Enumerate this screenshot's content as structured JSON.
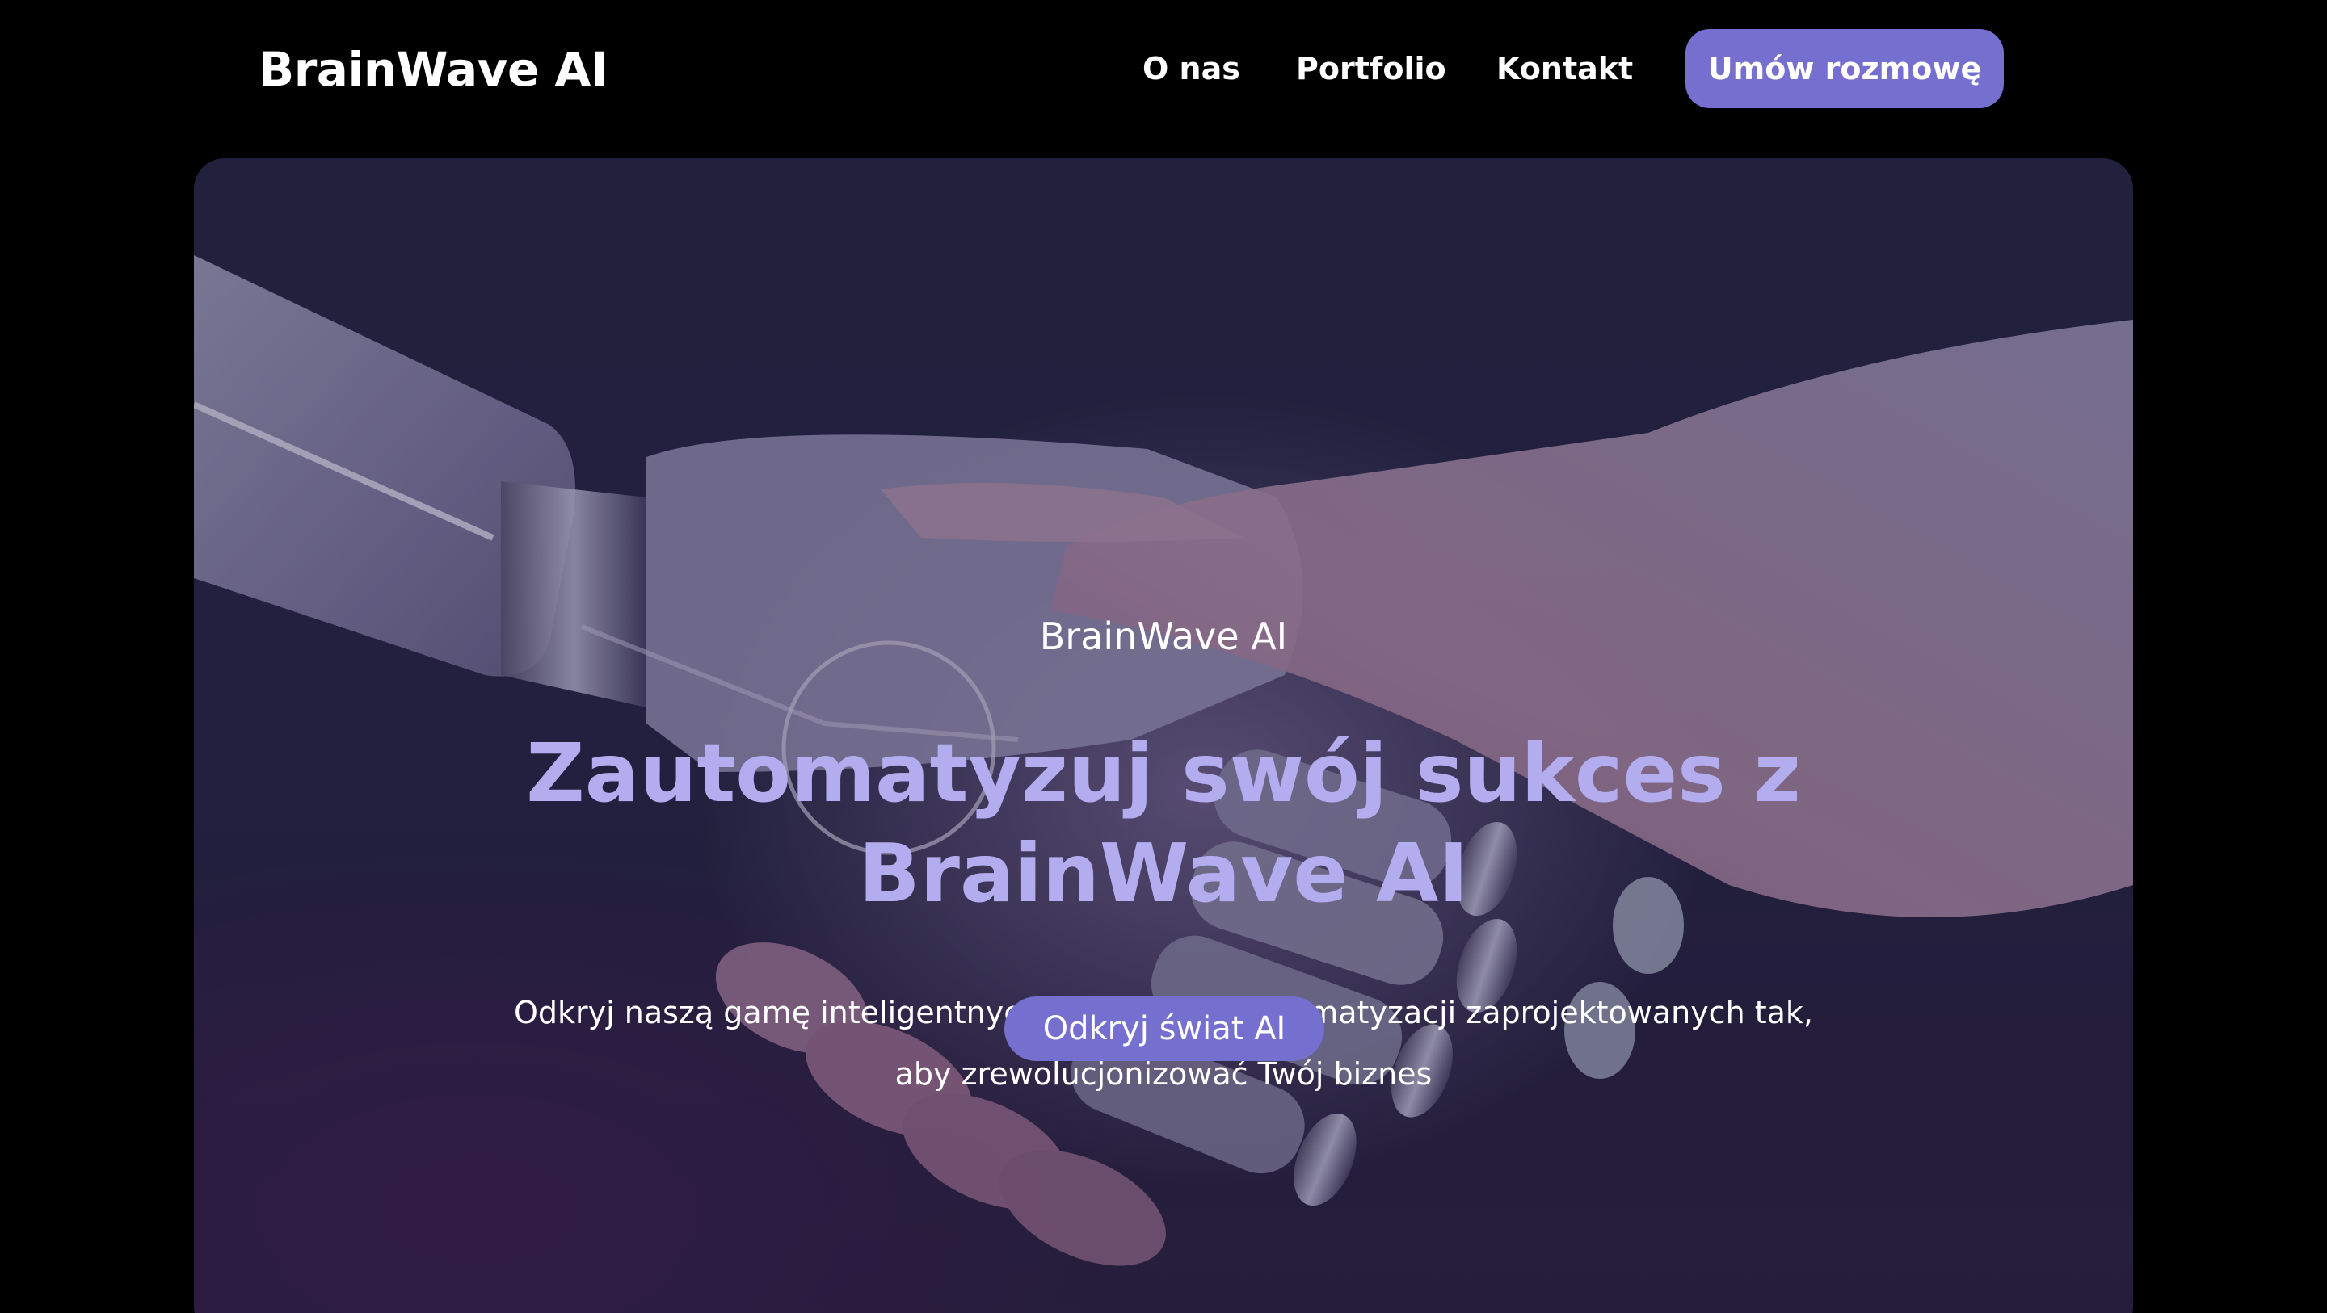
{
  "header": {
    "logo": "BrainWave AI",
    "nav": [
      "O nas",
      "Portfolio",
      "Kontakt"
    ],
    "cta_label": "Umów rozmowę"
  },
  "hero": {
    "eyebrow": "BrainWave AI",
    "headline": "Zautomatyzuj swój sukces z BrainWave AI",
    "subtext": "Odkryj naszą gamę inteligentnych chatbotów i automatyzacji zaprojektowanych tak, aby zrewolucjonizować Twój biznes",
    "button_label": "Odkryj świat AI",
    "image_subject": "robot-human-handshake-photo"
  },
  "colors": {
    "page_background": "#000000",
    "accent": "#7570d0",
    "headline": "#b3adf0",
    "text": "#ffffff"
  }
}
